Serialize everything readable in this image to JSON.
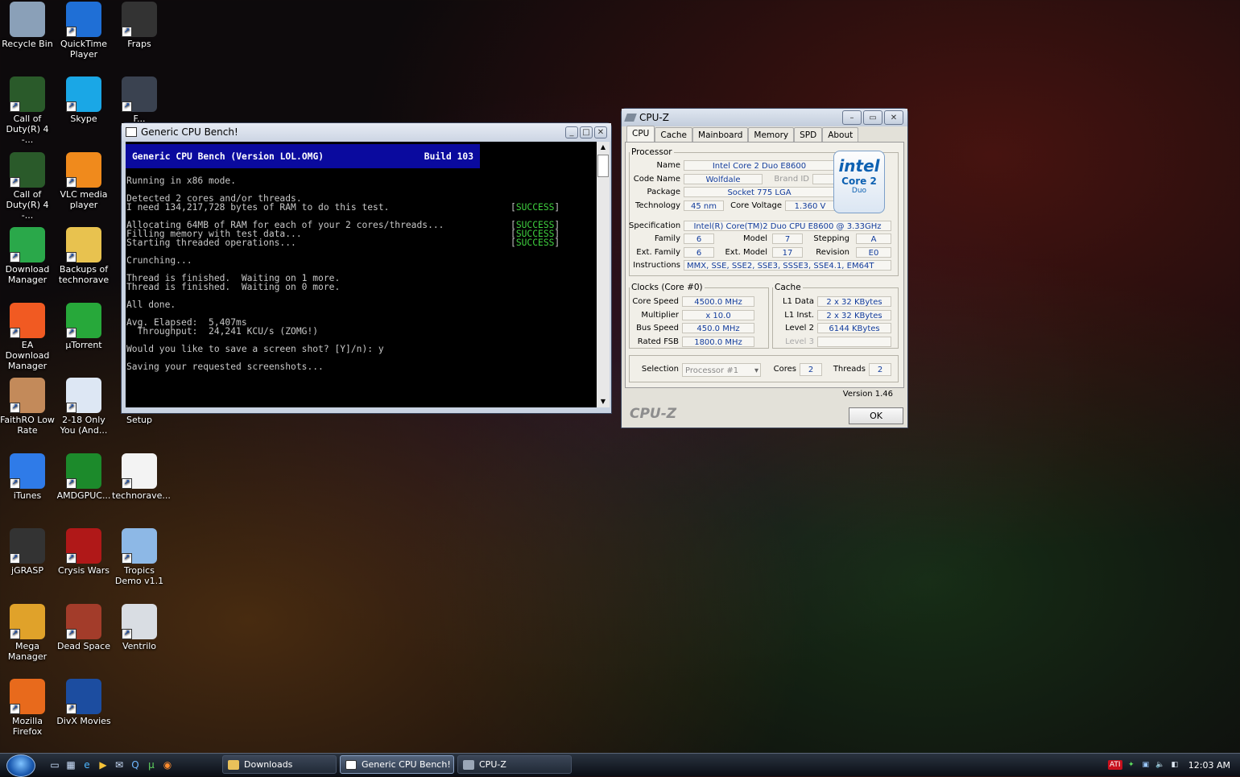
{
  "desktop": {
    "icons": [
      {
        "label": "Recycle Bin",
        "icon": "recycle-bin-icon"
      },
      {
        "label": "QuickTime Player",
        "icon": "quicktime-icon"
      },
      {
        "label": "Fraps",
        "icon": "fraps-icon"
      },
      {
        "label": "Call of Duty(R) 4 -...",
        "icon": "cod4-icon"
      },
      {
        "label": "Skype",
        "icon": "skype-icon"
      },
      {
        "label": "F...",
        "icon": "warcraft-icon"
      },
      {
        "label": "Call of Duty(R) 4 -...",
        "icon": "cod4-icon"
      },
      {
        "label": "VLC media player",
        "icon": "vlc-icon"
      },
      {
        "label": "Download Manager",
        "icon": "download-icon"
      },
      {
        "label": "Backups of technorave",
        "icon": "folder-icon"
      },
      {
        "label": "EA Download Manager",
        "icon": "ea-icon"
      },
      {
        "label": "µTorrent",
        "icon": "utorrent-icon"
      },
      {
        "label": "FaithRO Low Rate",
        "icon": "faithro-icon"
      },
      {
        "label": "2-18 Only You (And...",
        "icon": "movie-icon"
      },
      {
        "label": "Setup",
        "icon": "setup-icon"
      },
      {
        "label": "iTunes",
        "icon": "itunes-icon"
      },
      {
        "label": "AMDGPUC...",
        "icon": "amd-icon"
      },
      {
        "label": "technorave...",
        "icon": "document-icon"
      },
      {
        "label": "jGRASP",
        "icon": "jgrasp-icon"
      },
      {
        "label": "Crysis Wars",
        "icon": "crysis-icon"
      },
      {
        "label": "Tropics Demo v1.1",
        "icon": "tropics-icon"
      },
      {
        "label": "Mega Manager",
        "icon": "mega-icon"
      },
      {
        "label": "Dead Space",
        "icon": "deadspace-icon"
      },
      {
        "label": "Ventrilo",
        "icon": "ventrilo-icon"
      },
      {
        "label": "Mozilla Firefox",
        "icon": "firefox-icon"
      },
      {
        "label": "DivX Movies",
        "icon": "divx-icon"
      }
    ]
  },
  "console": {
    "title": "Generic CPU Bench!",
    "header_left": "Generic CPU Bench (Version LOL.OMG)",
    "header_right": "Build 103",
    "lines": [
      "Running in x86 mode.",
      "Detected 2 cores and/or threads.",
      "I need 134,217,728 bytes of RAM to do this test.",
      "Allocating 64MB of RAM for each of your 2 cores/threads...",
      "Filling memory with test data...",
      "Starting threaded operations...",
      "Crunching...",
      "Thread is finished.  Waiting on 1 more.",
      "Thread is finished.  Waiting on 0 more.",
      "All done.",
      "Avg. Elapsed:  5,407ms",
      "  Throughput:  24,241 KCU/s (ZOMG!)",
      "Would you like to save a screen shot? [Y]/n): y",
      "Saving your requested screenshots..."
    ],
    "success_label": "SUCCESS"
  },
  "cpuz": {
    "title": "CPU-Z",
    "tabs": [
      "CPU",
      "Cache",
      "Mainboard",
      "Memory",
      "SPD",
      "About"
    ],
    "processor_legend": "Processor",
    "name_label": "Name",
    "name": "Intel Core 2 Duo E8600",
    "codename_label": "Code Name",
    "codename": "Wolfdale",
    "brandid_label": "Brand ID",
    "package_label": "Package",
    "package": "Socket 775 LGA",
    "technology_label": "Technology",
    "technology": "45 nm",
    "voltage_label": "Core Voltage",
    "voltage": "1.360 V",
    "spec_label": "Specification",
    "spec": "Intel(R) Core(TM)2 Duo CPU     E8600  @ 3.33GHz",
    "family_label": "Family",
    "family": "6",
    "model_label": "Model",
    "model": "7",
    "stepping_label": "Stepping",
    "stepping": "A",
    "extfamily_label": "Ext. Family",
    "extfamily": "6",
    "extmodel_label": "Ext. Model",
    "extmodel": "17",
    "revision_label": "Revision",
    "revision": "E0",
    "instructions_label": "Instructions",
    "instructions": "MMX, SSE, SSE2, SSE3, SSSE3, SSE4.1, EM64T",
    "intel_logo": "intel",
    "intel_sub": "Core 2",
    "intel_sub2": "Duo",
    "clocks_legend": "Clocks (Core #0)",
    "corespeed_label": "Core Speed",
    "corespeed": "4500.0 MHz",
    "multiplier_label": "Multiplier",
    "multiplier": "x 10.0",
    "busspeed_label": "Bus Speed",
    "busspeed": "450.0 MHz",
    "ratedfsb_label": "Rated FSB",
    "ratedfsb": "1800.0 MHz",
    "cache_legend": "Cache",
    "l1data_label": "L1 Data",
    "l1data": "2 x 32 KBytes",
    "l1inst_label": "L1 Inst.",
    "l1inst": "2 x 32 KBytes",
    "level2_label": "Level 2",
    "level2": "6144 KBytes",
    "level3_label": "Level 3",
    "selection_label": "Selection",
    "selection": "Processor #1",
    "cores_label": "Cores",
    "cores": "2",
    "threads_label": "Threads",
    "threads": "2",
    "version": "Version 1.46",
    "brand": "CPU-Z",
    "ok": "OK"
  },
  "taskbar": {
    "tasks": [
      "Downloads",
      "Generic CPU Bench!",
      "CPU-Z"
    ],
    "clock": "12:03 AM",
    "tray_ati": "ATI"
  }
}
